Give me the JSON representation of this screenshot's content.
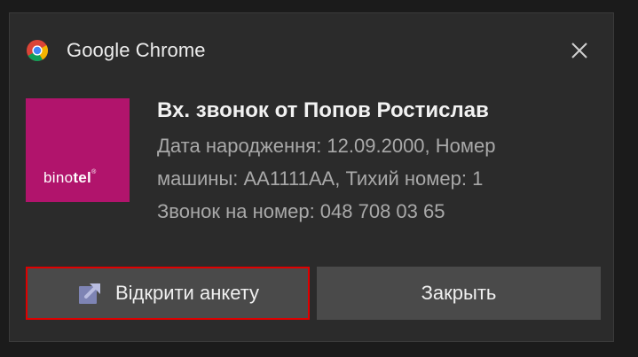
{
  "app": {
    "name": "Google Chrome"
  },
  "notification": {
    "title": "Вх. звонок от Попов Ростислав",
    "body_lines": [
      "Дата народження: 12.09.2000, Номер",
      "машины: AA1111AA, Тихий номер: 1",
      "Звонок на номер: 048 708 03 65"
    ]
  },
  "logo": {
    "part1": "bino",
    "part2": "tel",
    "mark": "®",
    "bg_color": "#b1146c"
  },
  "buttons": {
    "open_label": "Відкрити анкету",
    "close_label": "Закрыть"
  },
  "icons": {
    "app": "chrome-icon",
    "close": "close-icon",
    "open": "open-external-icon"
  },
  "colors": {
    "background": "#2b2b2b",
    "button": "#4a4a4a",
    "highlight": "#e00000"
  }
}
